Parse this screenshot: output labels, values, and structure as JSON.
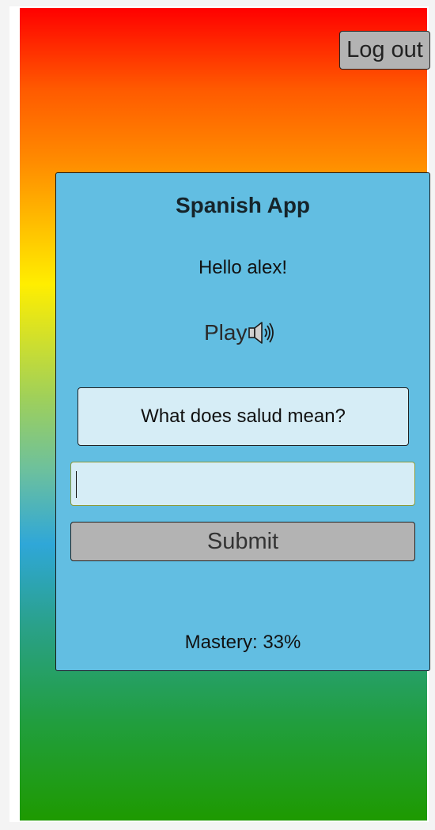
{
  "header": {
    "logout_label": "Log out"
  },
  "card": {
    "title": "Spanish App",
    "greeting": "Hello alex!",
    "play_label": "Play",
    "play_icon": "speaker-icon",
    "question": "What does salud mean?",
    "answer_value": "",
    "submit_label": "Submit",
    "mastery_text": "Mastery: 33%"
  },
  "colors": {
    "card_background": "#62bee2",
    "field_background": "#d6edf6",
    "button_background": "#b3b3b3",
    "gradient_top": "#ff0000",
    "gradient_bottom": "#1e9a00"
  }
}
